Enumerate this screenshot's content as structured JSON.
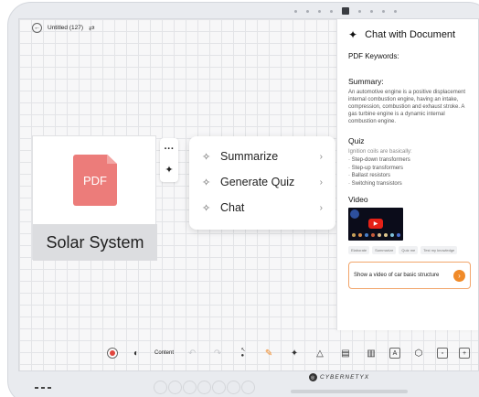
{
  "topbar": {
    "title": "Untitled (127)"
  },
  "pdf_card": {
    "icon_text": "PDF",
    "label": "Solar System"
  },
  "context_menu": {
    "items": [
      {
        "label": "Summarize"
      },
      {
        "label": "Generate Quiz"
      },
      {
        "label": "Chat"
      }
    ]
  },
  "chat_panel": {
    "title": "Chat with Document",
    "keywords_label": "PDF Keywords:",
    "summary_heading": "Summary:",
    "summary_text": "An automotive engine is a positive displacement internal combustion engine, having an intake, compression, combustion and exhaust stroke. A gas turbine engine is a dynamic internal combustion engine.",
    "quiz_heading": "Quiz",
    "quiz_question": "Ignition coils are basically:",
    "quiz_options": [
      "Step-down transformers",
      "Step-up transformers",
      "Ballast resistors",
      "Switching transistors"
    ],
    "video_heading": "Video",
    "chips": [
      "Elaborate",
      "Summarize",
      "Quiz me",
      "Test my knowledge"
    ],
    "prompt": "Show a video of car basic structure"
  },
  "bottom_toolbar": {
    "content_label": "Content"
  },
  "brand": "CYBERNETYX"
}
